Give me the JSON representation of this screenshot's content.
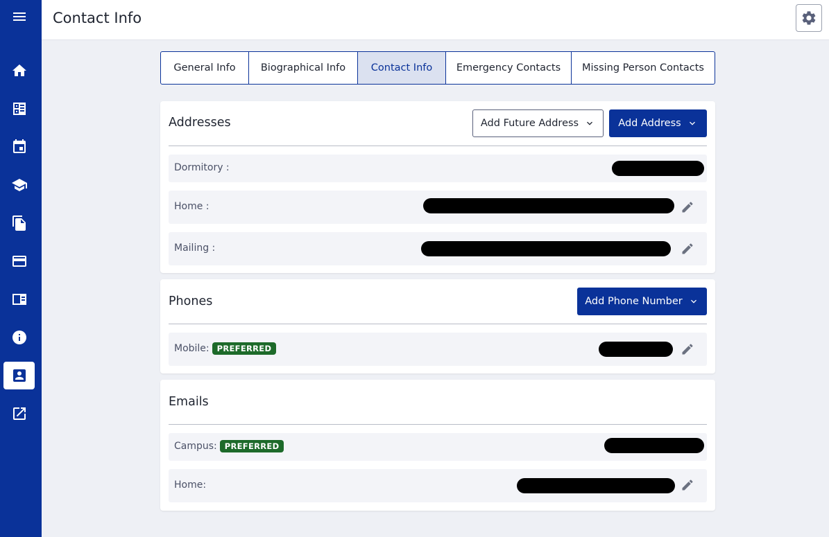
{
  "sidebar": {
    "items": [
      {
        "icon": "menu-icon"
      },
      {
        "icon": "home-icon"
      },
      {
        "icon": "dashboard-icon"
      },
      {
        "icon": "calendar-icon"
      },
      {
        "icon": "school-icon"
      },
      {
        "icon": "documents-icon"
      },
      {
        "icon": "credit-card-icon"
      },
      {
        "icon": "id-card-icon"
      },
      {
        "icon": "info-icon"
      },
      {
        "icon": "contact-icon",
        "active": true
      },
      {
        "icon": "open-external-icon"
      }
    ]
  },
  "header": {
    "title": "Contact Info",
    "settings_icon": "gear-icon"
  },
  "tabs": [
    {
      "label": "General Info"
    },
    {
      "label": "Biographical Info"
    },
    {
      "label": "Contact Info",
      "active": true
    },
    {
      "label": "Emergency Contacts"
    },
    {
      "label": "Missing Person Contacts"
    }
  ],
  "addresses": {
    "title": "Addresses",
    "add_future_label": "Add Future Address",
    "add_label": "Add Address",
    "rows": [
      {
        "label": "Dormitory :"
      },
      {
        "label": "Home :"
      },
      {
        "label": "Mailing :"
      }
    ]
  },
  "phones": {
    "title": "Phones",
    "add_label": "Add Phone Number",
    "rows": [
      {
        "label": "Mobile:",
        "badge": "PREFERRED"
      }
    ]
  },
  "emails": {
    "title": "Emails",
    "rows": [
      {
        "label": "Campus:",
        "badge": "PREFERRED"
      },
      {
        "label": "Home:"
      }
    ]
  },
  "colors": {
    "primary": "#0a3299",
    "badge": "#1d6a2a",
    "background": "#eef0f5"
  }
}
